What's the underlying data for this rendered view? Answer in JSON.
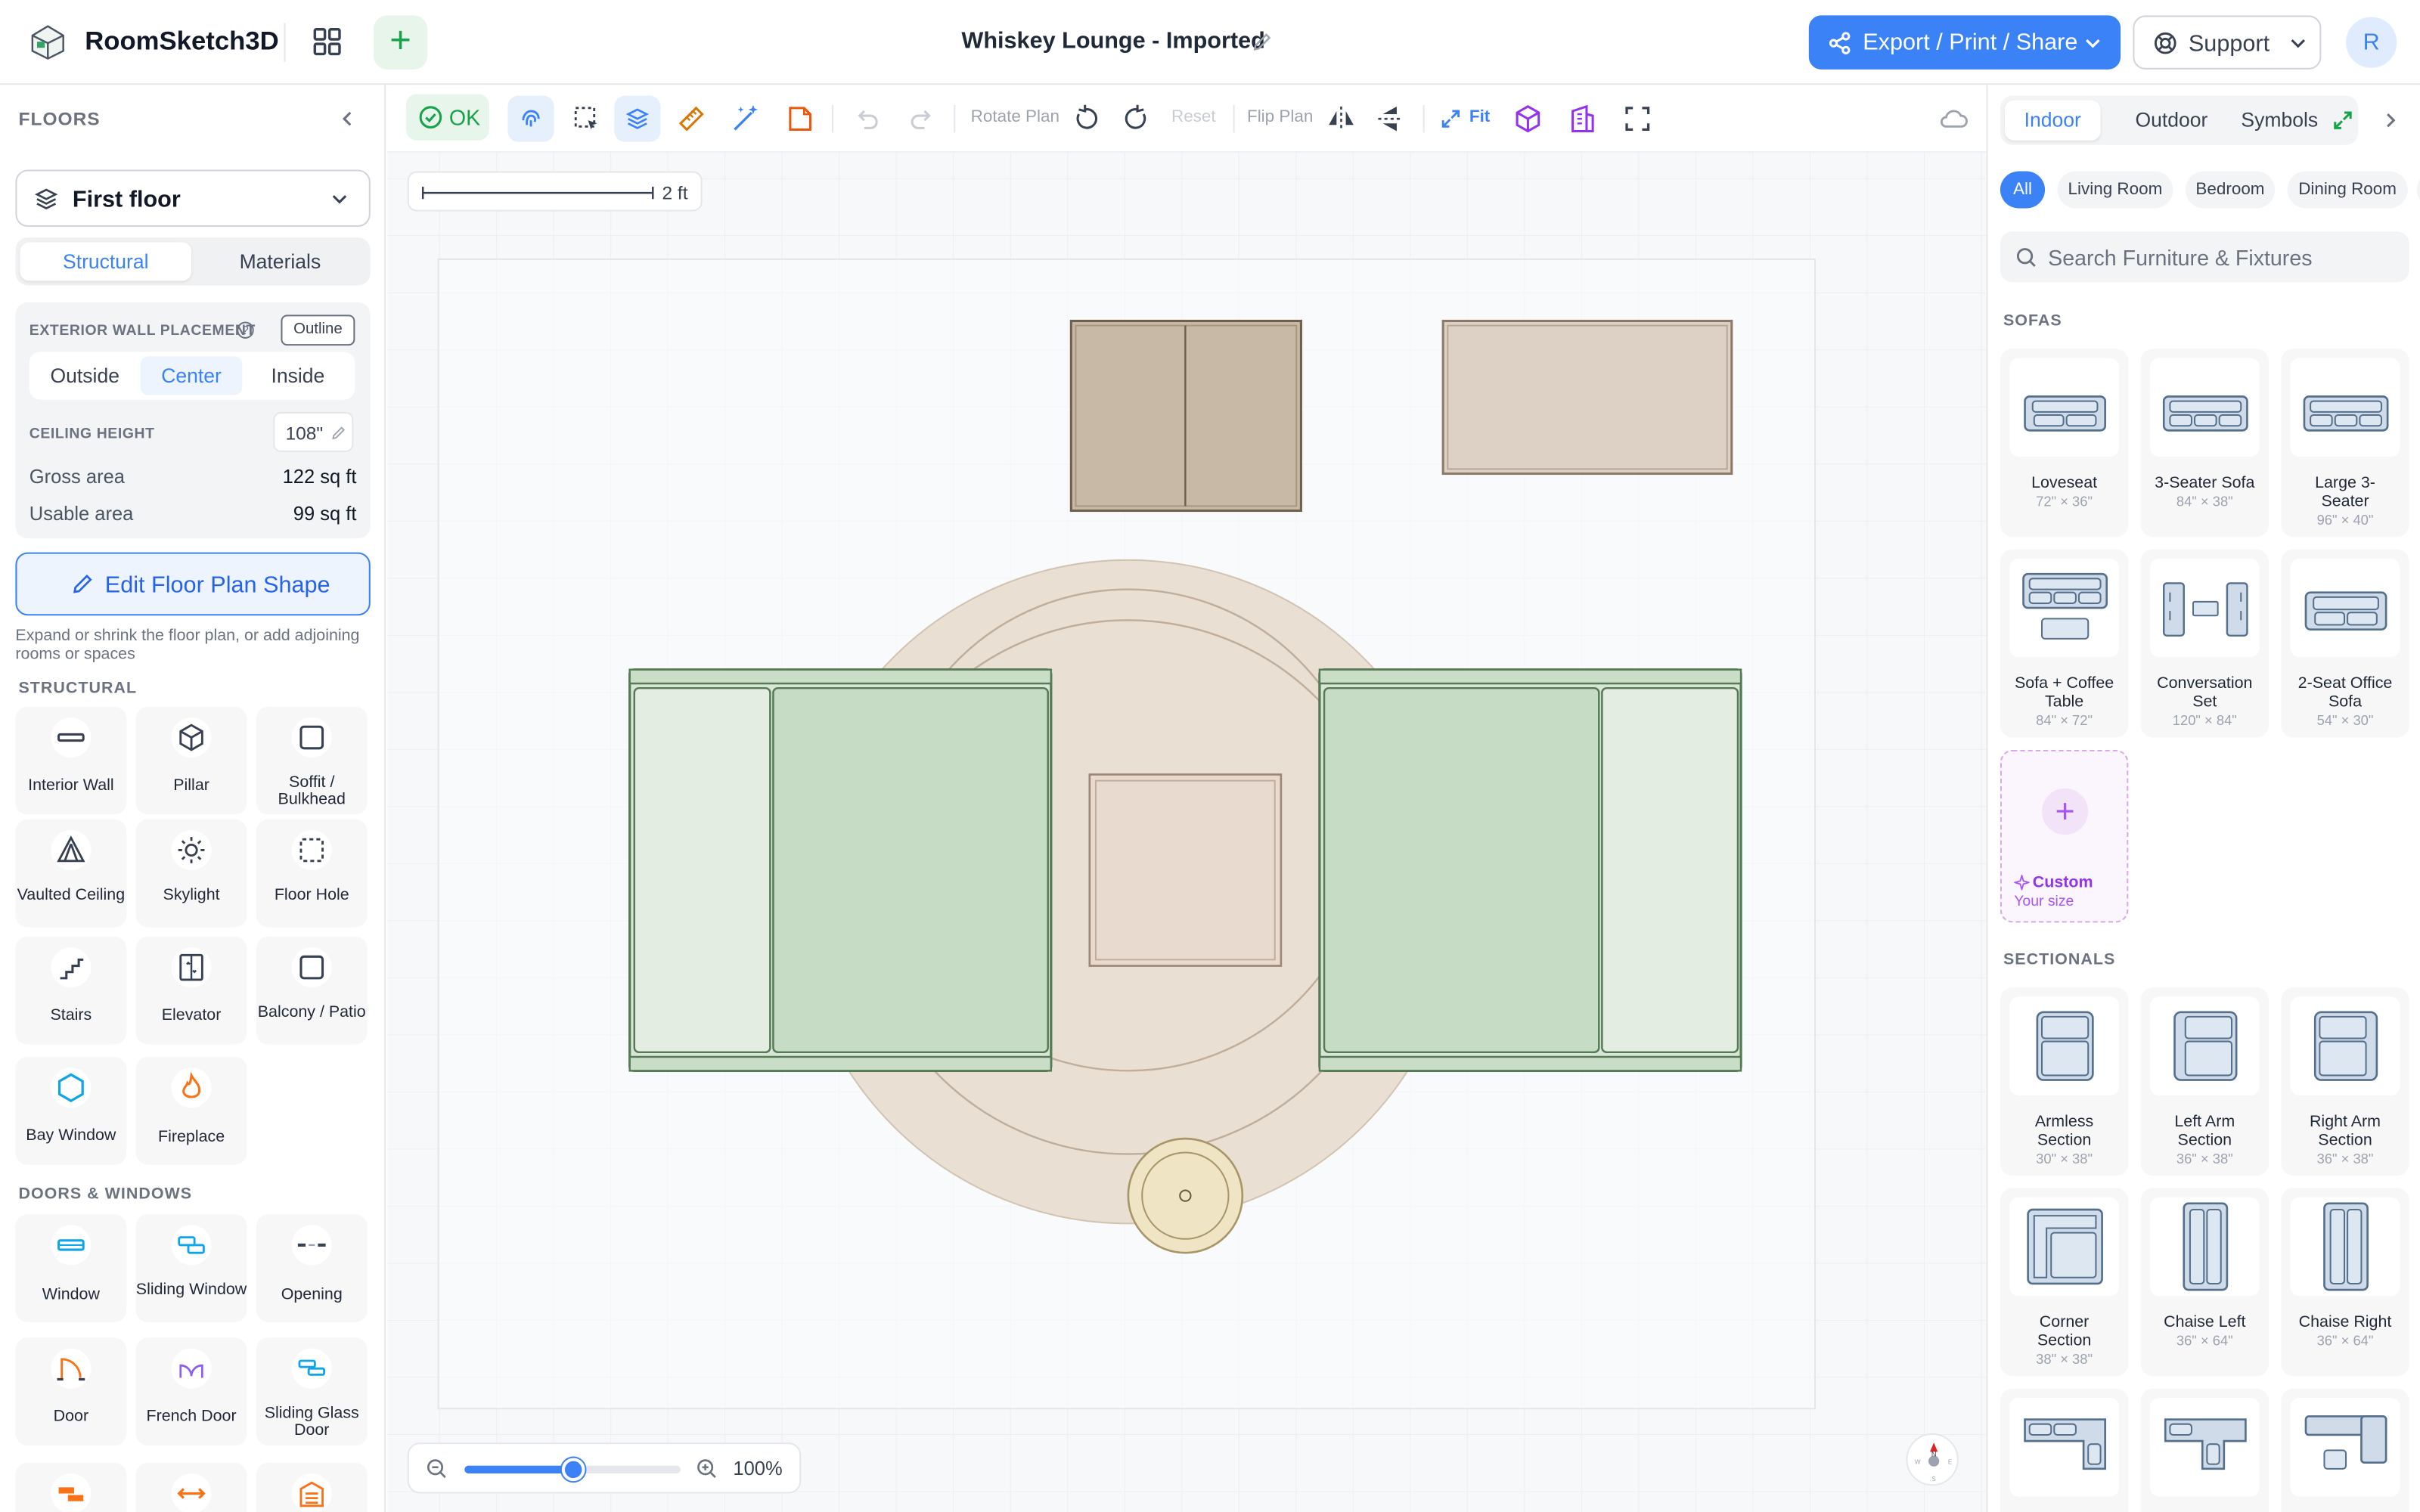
{
  "app": {
    "name": "RoomSketch3D",
    "document_title": "Whiskey Lounge - Imported",
    "avatar_initial": "R"
  },
  "header": {
    "export_label": "Export / Print / Share",
    "support_label": "Support"
  },
  "left_panel": {
    "title": "FLOORS",
    "floor_selected": "First floor",
    "tabs": [
      "Structural",
      "Materials"
    ],
    "active_tab": "Structural",
    "exterior_wall_label": "EXTERIOR WALL PLACEMENT",
    "outline_label": "Outline",
    "wall_options": [
      "Outside",
      "Center",
      "Inside"
    ],
    "wall_selected": "Center",
    "ceiling_label": "CEILING HEIGHT",
    "ceiling_value": "108\"",
    "gross_label": "Gross area",
    "gross_value": "122 sq ft",
    "usable_label": "Usable area",
    "usable_value": "99 sq ft",
    "edit_shape_label": "Edit Floor Plan Shape",
    "hint": "Expand or shrink the floor plan, or add adjoining rooms or spaces",
    "structural_title": "STRUCTURAL",
    "structural_items": [
      {
        "label": "Interior Wall",
        "icon": "interior-wall-icon"
      },
      {
        "label": "Pillar",
        "icon": "pillar-icon"
      },
      {
        "label": "Soffit / Bulkhead",
        "icon": "soffit-icon"
      },
      {
        "label": "Vaulted Ceiling",
        "icon": "vaulted-ceiling-icon"
      },
      {
        "label": "Skylight",
        "icon": "skylight-icon"
      },
      {
        "label": "Floor Hole",
        "icon": "floor-hole-icon"
      },
      {
        "label": "Stairs",
        "icon": "stairs-icon"
      },
      {
        "label": "Elevator",
        "icon": "elevator-icon"
      },
      {
        "label": "Balcony / Patio",
        "icon": "balcony-icon"
      },
      {
        "label": "Bay Window",
        "icon": "bay-window-icon"
      },
      {
        "label": "Fireplace",
        "icon": "fireplace-icon"
      }
    ],
    "doors_title": "DOORS & WINDOWS",
    "doors_items": [
      {
        "label": "Window",
        "icon": "window-icon"
      },
      {
        "label": "Sliding Window",
        "icon": "sliding-window-icon"
      },
      {
        "label": "Opening",
        "icon": "opening-icon"
      },
      {
        "label": "Door",
        "icon": "door-icon"
      },
      {
        "label": "French Door",
        "icon": "french-door-icon"
      },
      {
        "label": "Sliding Glass Door",
        "icon": "sliding-glass-door-icon"
      }
    ]
  },
  "toolbar": {
    "ok_label": "OK",
    "rotate_label": "Rotate Plan",
    "reset_label": "Reset",
    "flip_label": "Flip Plan",
    "fit_label": "Fit"
  },
  "canvas": {
    "scale_label": "2 ft",
    "zoom_label": "100%",
    "zoom_fraction": 0.5
  },
  "right_panel": {
    "tabs": [
      "Indoor",
      "Outdoor",
      "Symbols"
    ],
    "active_tab": "Indoor",
    "chips": [
      "All",
      "Living Room",
      "Bedroom",
      "Dining Room"
    ],
    "active_chip": "All",
    "search_placeholder": "Search Furniture & Fixtures",
    "sofas_title": "SOFAS",
    "sofas": [
      {
        "name": "Loveseat",
        "dims": "72\" × 36\""
      },
      {
        "name": "3-Seater Sofa",
        "dims": "84\" × 38\""
      },
      {
        "name": "Large 3-Seater",
        "dims": "96\" × 40\""
      },
      {
        "name": "Sofa + Coffee Table",
        "dims": "84\" × 72\""
      },
      {
        "name": "Conversation Set",
        "dims": "120\" × 84\""
      },
      {
        "name": "2-Seat Office Sofa",
        "dims": "54\" × 30\""
      }
    ],
    "custom": {
      "title": "Custom",
      "subtitle": "Your size"
    },
    "sectionals_title": "SECTIONALS",
    "sectionals": [
      {
        "name": "Armless Section",
        "dims": "30\" × 38\""
      },
      {
        "name": "Left Arm Section",
        "dims": "36\" × 38\""
      },
      {
        "name": "Right Arm Section",
        "dims": "36\" × 38\""
      },
      {
        "name": "Corner Section",
        "dims": "38\" × 38\""
      },
      {
        "name": "Chaise Left",
        "dims": "36\" × 64\""
      },
      {
        "name": "Chaise Right",
        "dims": "36\" × 64\""
      }
    ]
  },
  "colors": {
    "accent": "#3b82f6",
    "ok_green": "#16a34a",
    "sofa_green": "#cde0cc",
    "rug": "#e9dccd",
    "custom_purple": "#a855f7"
  }
}
